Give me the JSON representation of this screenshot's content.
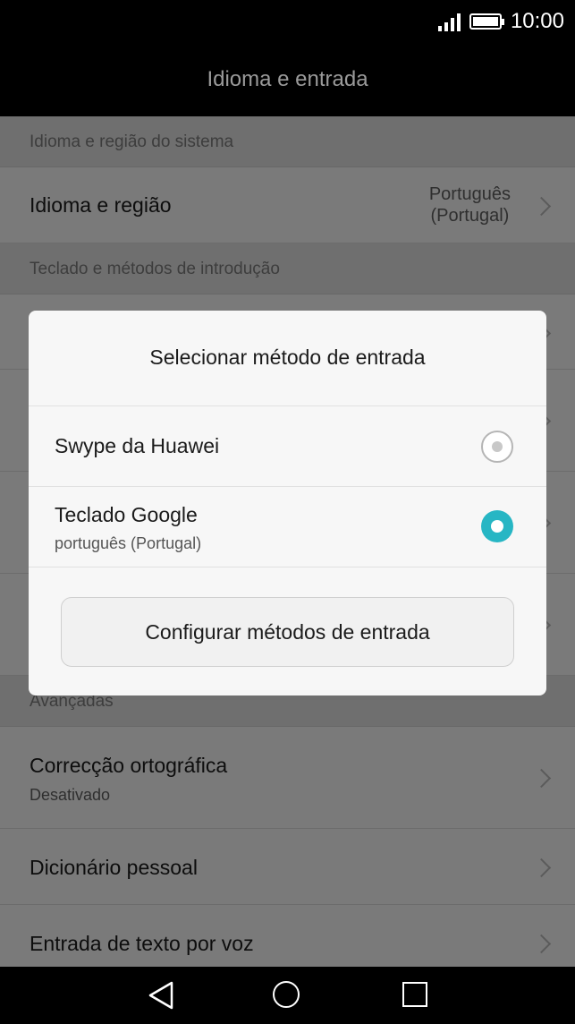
{
  "status_bar": {
    "time": "10:00",
    "signal_icon": "signal-icon",
    "battery_icon": "battery-icon"
  },
  "title_bar": {
    "title": "Idioma e entrada"
  },
  "settings": {
    "section_language": "Idioma e região do sistema",
    "language_row": {
      "title": "Idioma e região",
      "value_line1": "Português",
      "value_line2": "(Portugal)"
    },
    "section_keyboard": "Teclado e métodos de introdução",
    "section_advanced": "Avançadas",
    "spell_row": {
      "title": "Correcção ortográfica",
      "subtitle": "Desativado"
    },
    "dictionary_row": {
      "title": "Dicionário pessoal"
    },
    "voice_row": {
      "title": "Entrada de texto por voz"
    }
  },
  "dialog": {
    "title": "Selecionar método de entrada",
    "options": [
      {
        "label": "Swype da Huawei",
        "sublabel": "",
        "selected": false
      },
      {
        "label": "Teclado Google",
        "sublabel": "português (Portugal)",
        "selected": true
      }
    ],
    "configure_button": "Configurar métodos de entrada",
    "accent_color": "#27b6c4"
  },
  "nav_bar": {
    "back_icon": "back-triangle-icon",
    "home_icon": "home-circle-icon",
    "recents_icon": "recents-square-icon"
  }
}
